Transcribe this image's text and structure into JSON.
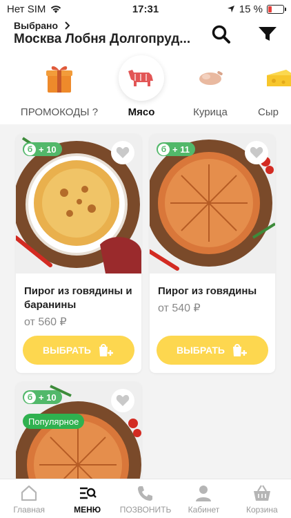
{
  "status_bar": {
    "carrier": "Нет SIM",
    "time": "17:31",
    "battery": "15 %"
  },
  "header": {
    "chosen_label": "Выбрано",
    "city": "Москва Лобня Долгопруд..."
  },
  "categories": [
    {
      "label": "ПРОМОКОДЫ ?",
      "icon": "gift-icon"
    },
    {
      "label": "Мясо",
      "icon": "cow-icon"
    },
    {
      "label": "Курица",
      "icon": "chicken-icon"
    },
    {
      "label": "Сыр",
      "icon": "cheese-icon"
    }
  ],
  "products": [
    {
      "bonus": "+ 10",
      "title": "Пирог из говядины и баранины",
      "price": "от 560 ₽",
      "button": "ВЫБРАТЬ"
    },
    {
      "bonus": "+ 11",
      "title": "Пирог из говядины",
      "price": "от 540 ₽",
      "button": "ВЫБРАТЬ"
    },
    {
      "bonus": "+ 10",
      "badge": "Популярное"
    }
  ],
  "bonus_letter": "б",
  "tabs": [
    {
      "label": "Главная"
    },
    {
      "label": "МЕНЮ"
    },
    {
      "label": "ПОЗВОНИТЬ"
    },
    {
      "label": "Кабинет"
    },
    {
      "label": "Корзина"
    }
  ],
  "colors": {
    "accent": "#fdd74f",
    "bonus": "#52b86a",
    "popular": "#2fb14f",
    "battery_low": "#e8413c"
  }
}
